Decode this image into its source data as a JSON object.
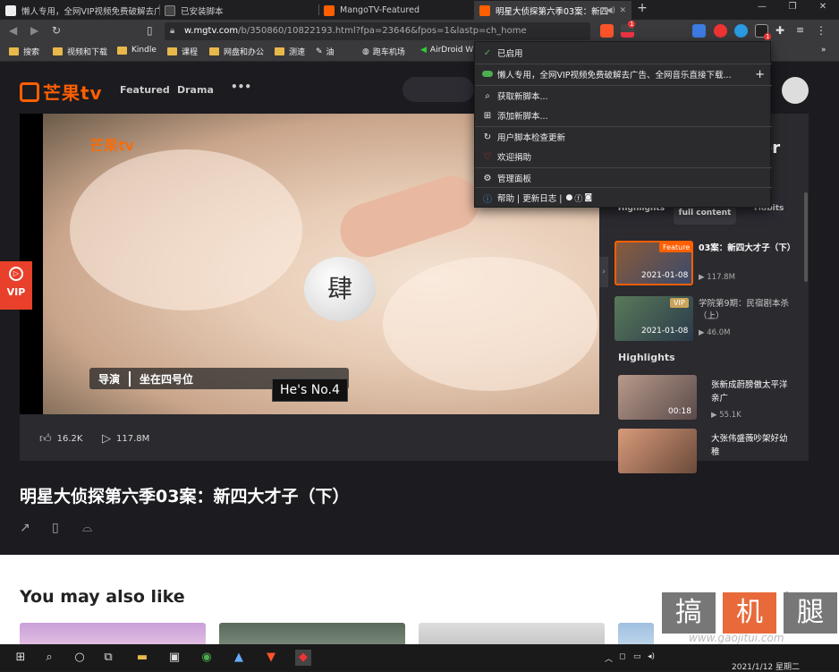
{
  "tabs": [
    {
      "title": "懒人专用，全网VIP视频免费破解去广",
      "active": false
    },
    {
      "title": "已安装脚本",
      "active": false
    },
    {
      "title": "MangoTV-Featured",
      "active": false
    },
    {
      "title": "明星大侦探第六季03案：新四",
      "active": true
    }
  ],
  "new_tab": "+",
  "address": {
    "domain": "w.mgtv.com",
    "path": "/b/350860/10822193.html?fpa=23646&fpos=1&lastp=ch_home"
  },
  "bookmarks": [
    "搜索",
    "视频和下载",
    "Kindle",
    "课程",
    "网盘和办公",
    "测速",
    "油",
    "跑车机场",
    "AirDroid W"
  ],
  "ext_badges": {
    "brave_count": "1",
    "tampermonkey_count": "1"
  },
  "site": {
    "logo_text": "芒果tv",
    "nav": [
      "Featured",
      "Drama"
    ],
    "more": "•••",
    "vip_badge": "VIP",
    "video": {
      "watermark": "芒果tv",
      "caption_left": "导演",
      "caption_right": "坐在四号位",
      "ball_char": "肆",
      "subtitle": "He's No.4",
      "likes": "16.2K",
      "plays": "117.8M"
    },
    "sidebar": {
      "partial_heading": "er",
      "tabs": [
        "Highlights",
        "full content",
        "Tidbits"
      ],
      "episodes": [
        {
          "tag": "Feature",
          "date": "2021-01-08",
          "title": "03案：新四大才子（下）",
          "views": "117.8M"
        },
        {
          "tag": "VIP",
          "date": "2021-01-08",
          "title": "学院第9期：民宿剧本杀（上）",
          "views": "46.0M"
        }
      ],
      "highlights_heading": "Highlights",
      "highlights": [
        {
          "duration": "00:18",
          "title": "张新成蔚膀傲太平洋亲广",
          "views": "55.1K"
        },
        {
          "duration": "",
          "title": "大张伟盛薇吵架好幼稚",
          "views": ""
        }
      ]
    },
    "title": "明星大侦探第六季03案：新四大才子（下）",
    "also_like": "You may also like"
  },
  "menu": {
    "enabled": "已启用",
    "script": "懒人专用，全网VIP视频免费破解去广告、全网音乐直接下载...",
    "plus": "+",
    "items": [
      "获取新脚本...",
      "添加新脚本...",
      "用户脚本检查更新",
      "欢迎捐助",
      "管理面板",
      "帮助 | 更新日志 |"
    ]
  },
  "watermark_site": {
    "chars": [
      "搞",
      "机",
      "腿"
    ],
    "url": "www.gaojitui.com"
  },
  "taskbar": {
    "time": "",
    "date": "2021/1/12 星期二"
  },
  "colors": {
    "accent": "#ff5f00",
    "menu_green": "#4caf50"
  }
}
